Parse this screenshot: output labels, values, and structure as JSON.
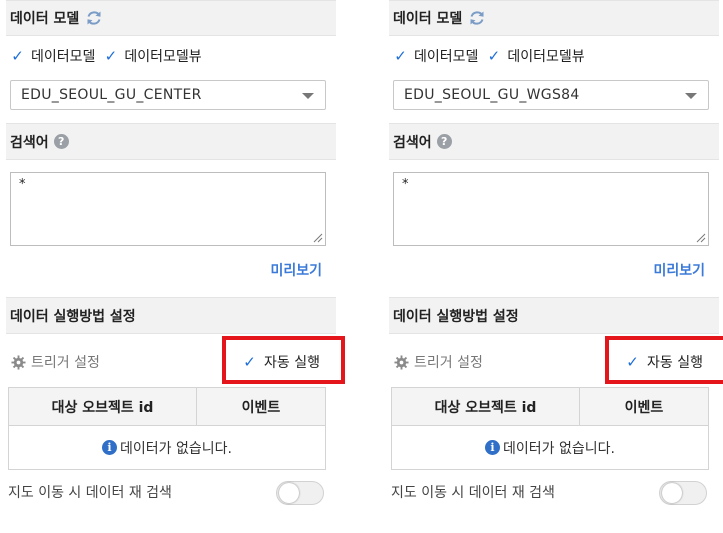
{
  "panels": [
    {
      "model_section_title": "데이터 모델",
      "checkbox_data_model": {
        "label": "데이터모델",
        "checked": true
      },
      "checkbox_data_model_view": {
        "label": "데이터모델뷰",
        "checked": true
      },
      "model_select": {
        "value": "EDU_SEOUL_GU_CENTER"
      },
      "search_section_title": "검색어",
      "search_textarea": {
        "value": "*"
      },
      "preview_label": "미리보기",
      "exec_section_title": "데이터 실행방법 설정",
      "trigger_label": "트리거 설정",
      "autorun": {
        "label": "자동 실행",
        "checked": true
      },
      "table": {
        "headers": [
          "대상 오브젝트 id",
          "이벤트"
        ],
        "empty_message": "데이터가 없습니다."
      },
      "map_research_label": "지도 이동 시 데이터 재 검색",
      "map_research_toggle": false
    },
    {
      "model_section_title": "데이터 모델",
      "checkbox_data_model": {
        "label": "데이터모델",
        "checked": true
      },
      "checkbox_data_model_view": {
        "label": "데이터모델뷰",
        "checked": true
      },
      "model_select": {
        "value": "EDU_SEOUL_GU_WGS84"
      },
      "search_section_title": "검색어",
      "search_textarea": {
        "value": "*"
      },
      "preview_label": "미리보기",
      "exec_section_title": "데이터 실행방법 설정",
      "trigger_label": "트리거 설정",
      "autorun": {
        "label": "자동 실행",
        "checked": true
      },
      "table": {
        "headers": [
          "대상 오브젝트 id",
          "이벤트"
        ],
        "empty_message": "데이터가 없습니다."
      },
      "map_research_label": "지도 이동 시 데이터 재 검색",
      "map_research_toggle": false
    }
  ],
  "icons": {
    "refresh": "refresh-icon",
    "help": "help-icon",
    "check": "checkmark-icon",
    "caret": "chevron-down-icon",
    "gear": "gear-icon",
    "info": "info-icon"
  },
  "colors": {
    "accent": "#1e6fd9",
    "link": "#3b7ad9",
    "highlight_box": "#e4151b",
    "section_bg": "#f2f2f2"
  }
}
